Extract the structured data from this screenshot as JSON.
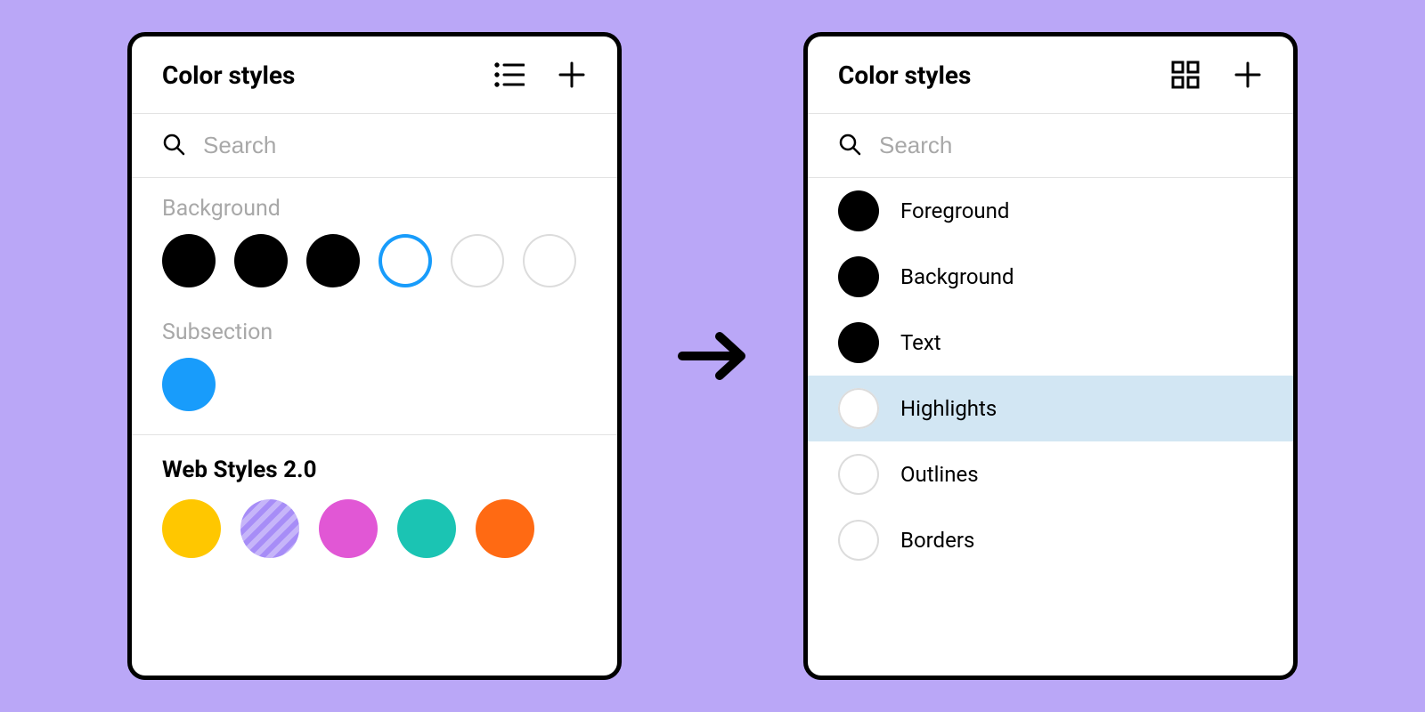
{
  "colors": {
    "black": "#000000",
    "white": "#ffffff",
    "blue": "#189CFB",
    "selection_bg": "#D2E6F3",
    "yellow": "#FFC700",
    "purple_pattern": "#A78DF7",
    "magenta": "#E157D5",
    "teal": "#1BC4B3",
    "orange": "#FF6A13"
  },
  "left_panel": {
    "title": "Color styles",
    "view_toggle_icon": "list-icon",
    "search_placeholder": "Search",
    "sections": [
      {
        "label": "Background",
        "swatches": [
          {
            "fill": "black"
          },
          {
            "fill": "black"
          },
          {
            "fill": "black"
          },
          {
            "fill": "white",
            "selected": true
          },
          {
            "fill": "white",
            "light_outline": true
          },
          {
            "fill": "white",
            "light_outline": true
          }
        ]
      },
      {
        "label": "Subsection",
        "swatches": [
          {
            "fill": "blue"
          }
        ]
      }
    ],
    "web_section": {
      "title": "Web Styles 2.0",
      "swatches": [
        "yellow",
        "purple_pattern",
        "magenta",
        "teal",
        "orange"
      ]
    }
  },
  "right_panel": {
    "title": "Color styles",
    "view_toggle_icon": "grid-icon",
    "search_placeholder": "Search",
    "items": [
      {
        "label": "Foreground",
        "fill": "black"
      },
      {
        "label": "Background",
        "fill": "black"
      },
      {
        "label": "Text",
        "fill": "black"
      },
      {
        "label": "Highlights",
        "fill": "white",
        "light_outline": true,
        "selected": true
      },
      {
        "label": "Outlines",
        "fill": "white",
        "light_outline": true
      },
      {
        "label": "Borders",
        "fill": "white",
        "light_outline": true
      }
    ]
  }
}
